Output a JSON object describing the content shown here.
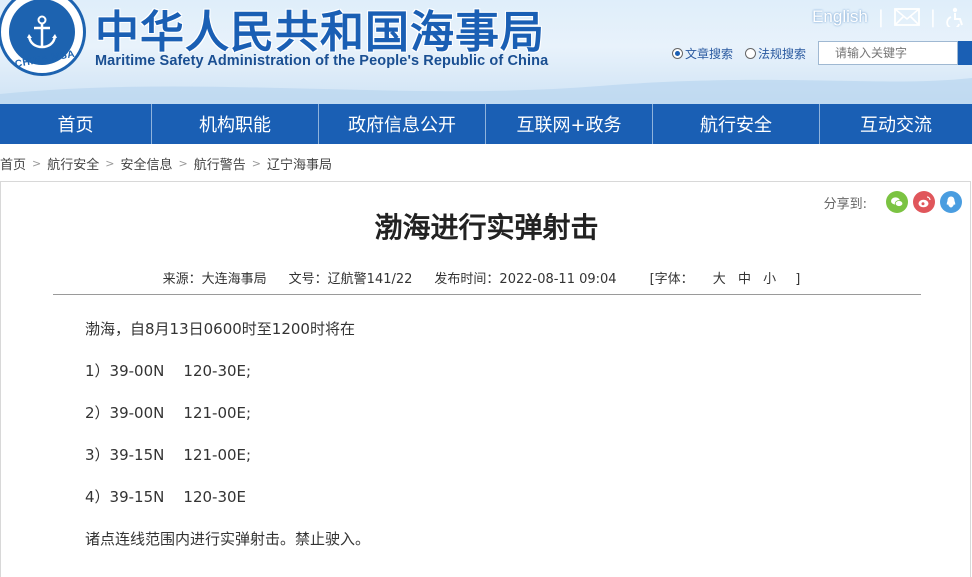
{
  "header": {
    "logo_text": "CHINA MSA",
    "title_cn": "中华人民共和国海事局",
    "title_en": "Maritime Safety Administration of the People's Republic of China",
    "english_link": "English",
    "separator": "|",
    "icons": [
      "mail-icon",
      "accessibility-icon"
    ],
    "search": {
      "options": [
        "文章搜索",
        "法规搜索"
      ],
      "selected": "文章搜索",
      "placeholder": "请输入关键字"
    }
  },
  "nav": {
    "items": [
      "首页",
      "机构职能",
      "政府信息公开",
      "互联网+政务",
      "航行安全",
      "互动交流"
    ]
  },
  "breadcrumb": {
    "items": [
      "首页",
      "航行安全",
      "安全信息",
      "航行警告",
      "辽宁海事局"
    ],
    "separator": ">"
  },
  "article": {
    "share_label": "分享到:",
    "share_icons": [
      "wechat-icon",
      "weibo-icon",
      "qq-icon"
    ],
    "title": "渤海进行实弹射击",
    "meta": {
      "source": "来源：大连海事局",
      "doc_no": "文号：辽航警141/22",
      "published": "发布时间：2022-08-11 09:04",
      "font_label": "[字体：",
      "font_large": "大",
      "font_medium": "中",
      "font_small": "小",
      "font_close": "]"
    },
    "paragraphs": [
      "渤海，自8月13日0600时至1200时将在",
      "1）39-00N    120-30E;",
      "2）39-00N    121-00E;",
      "3）39-15N    121-00E;",
      "4）39-15N    120-30E",
      "诸点连线范围内进行实弹射击。禁止驶入。"
    ]
  },
  "colors": {
    "brand_blue": "#1a5fb4",
    "nav_bg": "#1a5fb4",
    "wechat": "#7bc342",
    "weibo": "#e0565b",
    "qq": "#4a9de0"
  }
}
